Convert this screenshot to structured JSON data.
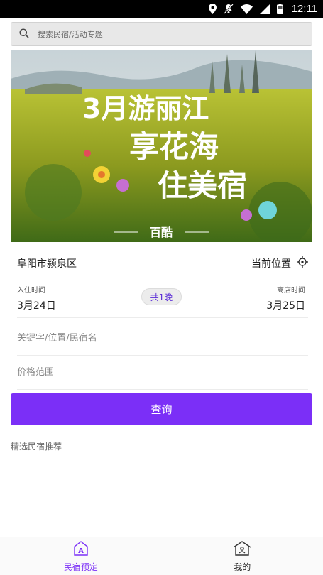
{
  "status_bar": {
    "time": "12:11",
    "icons": [
      "location-icon",
      "mute-icon",
      "wifi-icon",
      "signal-icon",
      "battery-icon"
    ]
  },
  "search": {
    "placeholder": "搜索民宿/活动专题",
    "icon": "search-icon"
  },
  "banner": {
    "line1": "3月游丽江",
    "line2": "享花海",
    "line3": "住美宿",
    "logo": "百酷"
  },
  "location": {
    "city": "阜阳市颍泉区",
    "current_label": "当前位置",
    "icon": "locate-icon"
  },
  "dates": {
    "checkin_label": "入住时间",
    "checkin_value": "3月24日",
    "nights_label": "共1晚",
    "checkout_label": "离店时间",
    "checkout_value": "3月25日"
  },
  "keyword": {
    "placeholder": "关键字/位置/民宿名"
  },
  "price": {
    "placeholder": "价格范围"
  },
  "query_button": {
    "label": "查询"
  },
  "section": {
    "title": "精选民宿推荐"
  },
  "tabs": [
    {
      "label": "民宿预定",
      "icon": "homestay-icon",
      "active": true
    },
    {
      "label": "我的",
      "icon": "my-home-icon",
      "active": false
    }
  ],
  "colors": {
    "accent": "#7b2ff7",
    "status_bar": "#000000",
    "search_bg": "#e8e8e8"
  }
}
